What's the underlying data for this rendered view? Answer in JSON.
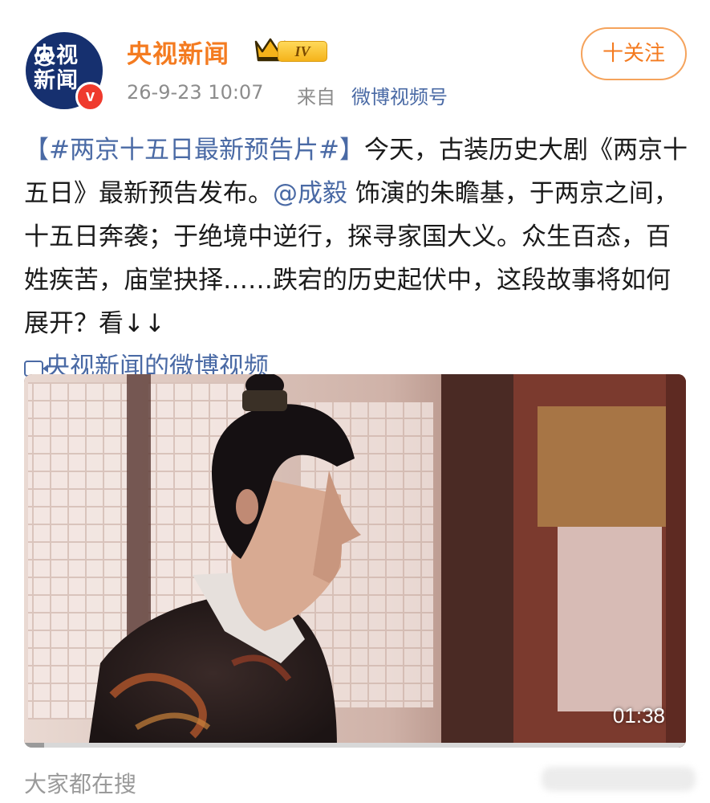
{
  "account": {
    "avatar_text": "央视\n新闻",
    "avatar_at": "@",
    "verified_mark": "v",
    "name": "央视新闻",
    "level": "IV",
    "icons": [
      "crown-icon",
      "verified-icon"
    ]
  },
  "meta": {
    "time": "26-9-23 10:07",
    "from_label": "来自",
    "source": "微博视频号"
  },
  "follow_button": "十关注",
  "post": {
    "topic": "【#两京十五日最新预告片#】",
    "text_1": "今天，古装历史大剧《两京十五日》最新预告发布。",
    "mention": "@成毅",
    "text_2": " 饰演的朱瞻基，于两京之间，十五日奔袭；于绝境中逆行，探寻家国大义。众生百态，百姓疾苦，庙堂抉择……跌宕的历史起伏中，这段故事将如何展开？看↓↓",
    "video_link": "央视新闻的微博视频",
    "video_link_icon": "video-camera-icon"
  },
  "video": {
    "duration": "01:38",
    "progress": 0.03
  },
  "footer": {
    "trending_label": "大家都在搜"
  },
  "colors": {
    "brand_orange": "#f47b20",
    "link_blue": "#4a6aa5",
    "avatar_navy": "#16306f",
    "verified_red": "#ef3a2d"
  }
}
